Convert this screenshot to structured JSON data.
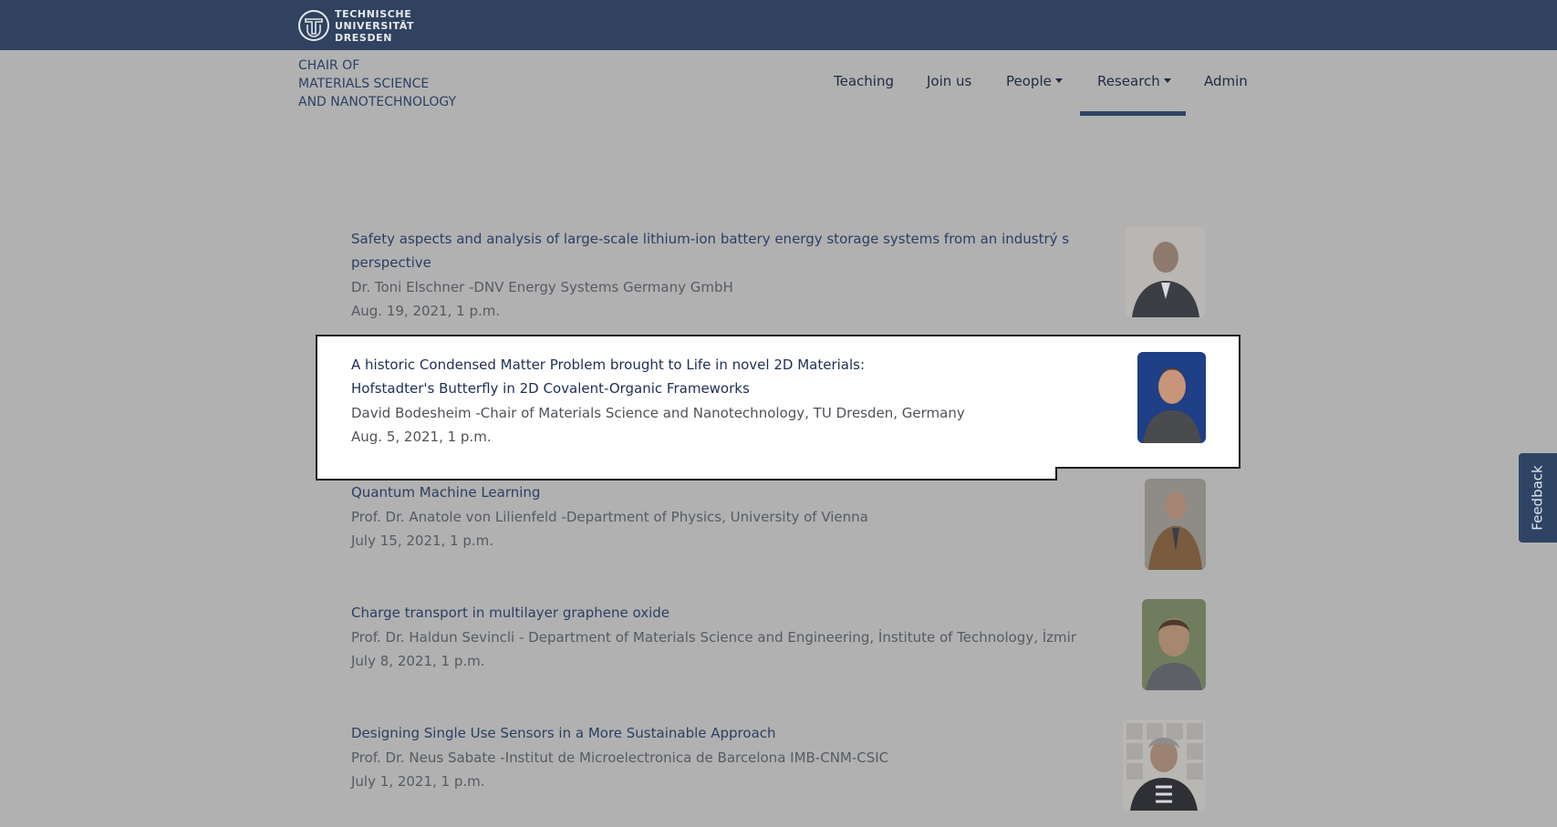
{
  "header": {
    "logo_lines": [
      "TECHNISCHE",
      "UNIVERSITÄT",
      "DRESDEN"
    ],
    "chair_lines": [
      "CHAIR OF",
      "MATERIALS SCIENCE",
      "AND NANOTECHNOLOGY"
    ]
  },
  "nav": {
    "items": [
      {
        "label": "Teaching"
      },
      {
        "label": "Join us"
      },
      {
        "label": "People"
      },
      {
        "label": "Research"
      },
      {
        "label": "Admin"
      }
    ],
    "active": "Research"
  },
  "talks": [
    {
      "title_lines": [
        "Safety aspects and analysis of large-scale lithium-ion battery energy storage systems from an industrý s",
        "perspective"
      ],
      "speaker": "Dr. Toni Elschner  -DNV Energy Systems Germany GmbH",
      "date": "Aug. 19, 2021, 1 p.m."
    },
    {
      "title_lines": [
        "A historic Condensed Matter Problem brought to Life in novel 2D Materials:",
        "Hofstadter's Butterfly in 2D Covalent-Organic Frameworks"
      ],
      "speaker": "David Bodesheim  -Chair of Materials Science and Nanotechnology, TU Dresden, Germany",
      "date": "Aug. 5, 2021, 1 p.m."
    },
    {
      "title_lines": [
        "Quantum Machine Learning"
      ],
      "speaker": "Prof. Dr. Anatole von Lilienfeld  -Department of Physics, University of Vienna",
      "date": "July 15, 2021, 1 p.m."
    },
    {
      "title_lines": [
        "Charge transport in multilayer graphene oxide"
      ],
      "speaker": "Prof. Dr. Haldun Sevincli - Department of Materials Science and Engineering, İnstitute of Technology, İzmir",
      "date": "July 8, 2021, 1 p.m."
    },
    {
      "title_lines": [
        "Designing Single Use Sensors in a More Sustainable Approach"
      ],
      "speaker": "Prof. Dr. Neus Sabate  -Institut de Microelectronica de Barcelona IMB-CNM-CSIC",
      "date": "July 1, 2021, 1 p.m."
    }
  ],
  "feedback": {
    "label": "Feedback"
  },
  "colors": {
    "topbar": "#30425f",
    "overlay": "#b1b1b1",
    "link": "#2b3f63",
    "muted": "#555b63"
  }
}
